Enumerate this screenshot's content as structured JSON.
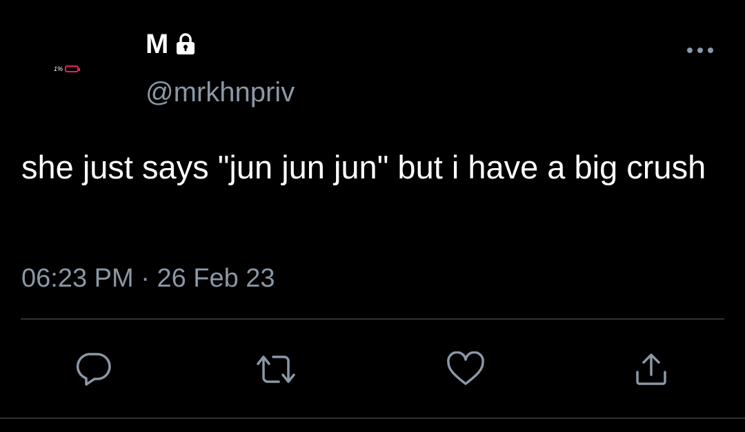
{
  "tweet": {
    "avatar_text": "1%",
    "display_name": "M",
    "handle": "@mrkhnpriv",
    "text": "she just says \"jun jun jun\" but i have a big crush",
    "time": "06:23 PM",
    "separator": "·",
    "date": "26 Feb 23"
  },
  "icons": {
    "lock": "lock-icon",
    "more": "more-icon",
    "reply": "reply-icon",
    "retweet": "retweet-icon",
    "like": "like-icon",
    "share": "share-icon",
    "battery": "battery-icon"
  },
  "colors": {
    "background": "#000000",
    "primary_text": "#ffffff",
    "secondary_text": "#8b98a5",
    "divider": "#2f3336",
    "battery_low": "#e0245e"
  }
}
